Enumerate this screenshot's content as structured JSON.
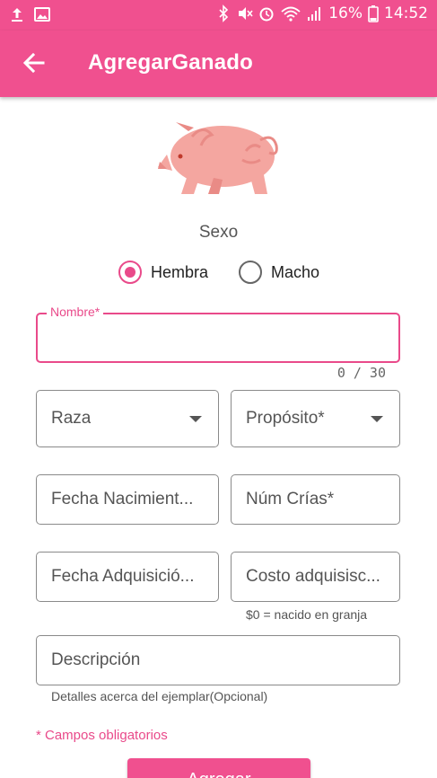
{
  "statusbar": {
    "battery": "16%",
    "time": "14:52",
    "icons": [
      "upload-icon",
      "image-icon",
      "bluetooth-icon",
      "mute-icon",
      "alarm-icon",
      "wifi-icon",
      "signal-icon",
      "battery-icon"
    ]
  },
  "appbar": {
    "title": "AgregarGanado",
    "back_icon": "arrow-left-icon"
  },
  "colors": {
    "primary": "#f0508f",
    "accent": "#e94a8a"
  },
  "form": {
    "sexo_label": "Sexo",
    "sexo_options": [
      {
        "label": "Hembra",
        "selected": true
      },
      {
        "label": "Macho",
        "selected": false
      }
    ],
    "nombre": {
      "label": "Nombre*",
      "value": "",
      "counter": "0 / 30"
    },
    "raza": {
      "placeholder": "Raza"
    },
    "proposito": {
      "placeholder": "Propósito*"
    },
    "fecha_nacimiento": {
      "placeholder": "Fecha Nacimient..."
    },
    "num_crias": {
      "placeholder": "Núm Crías*"
    },
    "fecha_adquisicion": {
      "placeholder": "Fecha Adquisició..."
    },
    "costo": {
      "placeholder": "Costo adquisisc...",
      "helper": "$0 = nacido en granja"
    },
    "descripcion": {
      "placeholder": "Descripción",
      "helper": "Detalles acerca del ejemplar(Opcional)"
    },
    "required_note": "* Campos obligatorios",
    "submit_label": "Agregar"
  }
}
